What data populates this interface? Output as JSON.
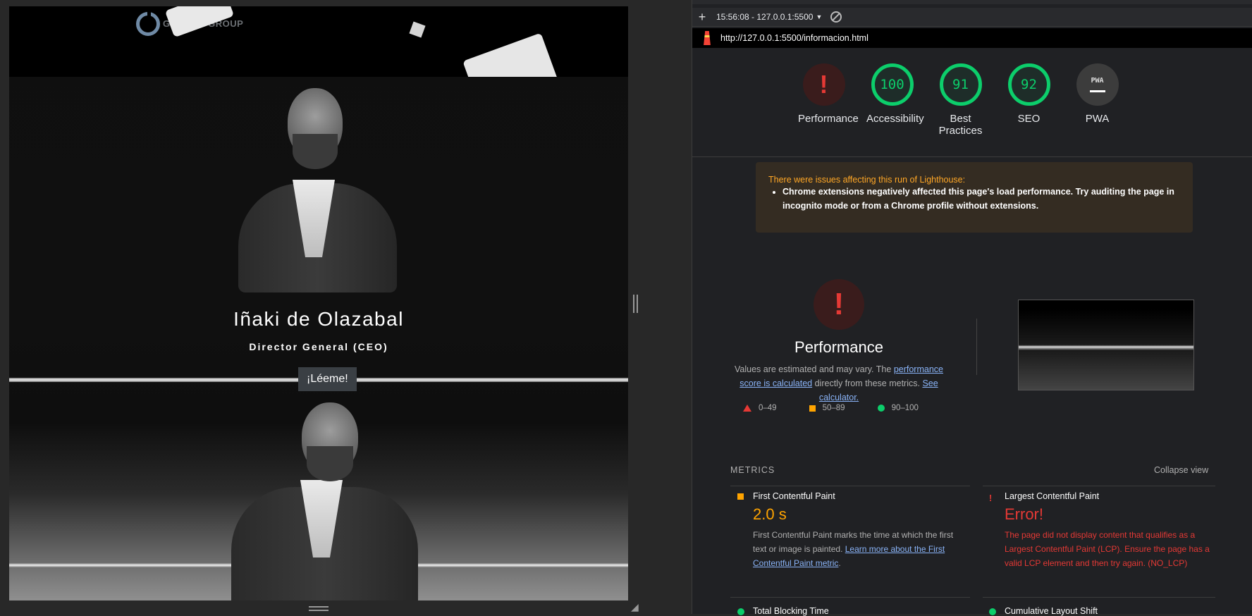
{
  "viewport": {
    "logo_text": "GOMESS GROUP",
    "person_name": "Iñaki de Olazabal",
    "person_role": "Director General (CEO)",
    "read_button": "¡Léeme!"
  },
  "devtools": {
    "toolbar": {
      "report_selector": "15:56:08 - 127.0.0.1:5500"
    },
    "url": "http://127.0.0.1:5500/informacion.html",
    "gauges": [
      {
        "label": "Performance",
        "score": "!"
      },
      {
        "label": "Accessibility",
        "score": "100"
      },
      {
        "label": "Best Practices",
        "score": "91"
      },
      {
        "label": "SEO",
        "score": "92"
      },
      {
        "label": "PWA",
        "score": "PWA"
      }
    ],
    "warning": {
      "title": "There were issues affecting this run of Lighthouse:",
      "item": "Chrome extensions negatively affected this page's load performance. Try auditing the page in incognito mode or from a Chrome profile without extensions."
    },
    "performance": {
      "icon": "!",
      "title": "Performance",
      "desc_prefix": "Values are estimated and may vary. The",
      "desc_link1": "performance score is calculated",
      "desc_middle": "directly from these metrics.",
      "desc_link2": "See calculator."
    },
    "legend": [
      "0–49",
      "50–89",
      "90–100"
    ],
    "metrics_header": "METRICS",
    "collapse_label": "Collapse view",
    "metrics": [
      {
        "title": "First Contentful Paint",
        "value": "2.0 s",
        "desc": "First Contentful Paint marks the time at which the first text or image is painted.",
        "link": "Learn more about the First Contentful Paint metric",
        "color": "#ffa400"
      },
      {
        "title": "Largest Contentful Paint",
        "value": "Error!",
        "desc": "The page did not display content that qualifies as a Largest Contentful Paint (LCP). Ensure the page has a valid LCP element and then try again. (NO_LCP)",
        "color": "#e53935"
      },
      {
        "title": "Total Blocking Time",
        "color": "#0cce6b"
      },
      {
        "title": "Cumulative Layout Shift",
        "color": "#0cce6b"
      }
    ],
    "colors": {
      "fail": "#e53935",
      "average": "#ffa400",
      "pass": "#0cce6b"
    }
  }
}
